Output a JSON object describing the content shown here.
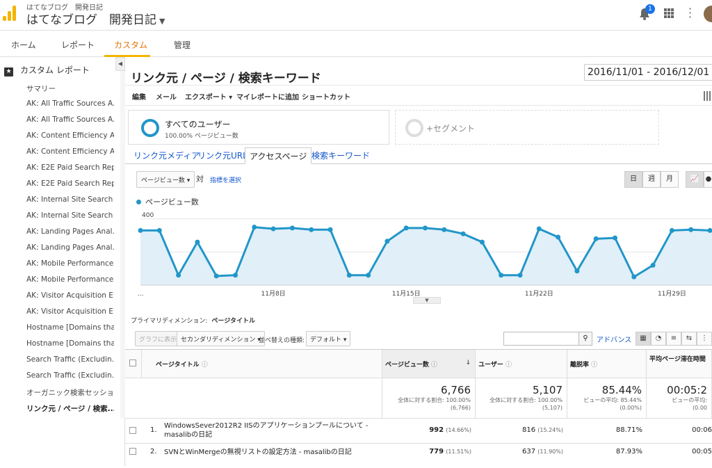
{
  "header": {
    "account": "はてなブログ　開発日記",
    "property": "はてなブログ　開発日記",
    "notification_count": "1",
    "colors": {
      "logo": "#f4b400",
      "accent": "#e37400",
      "series": "#2196c9"
    }
  },
  "nav": {
    "tabs": [
      {
        "label": "ホーム"
      },
      {
        "label": "レポート"
      },
      {
        "label": "カスタム",
        "active": true
      },
      {
        "label": "管理"
      }
    ]
  },
  "sidebar": {
    "heading": "カスタム レポート",
    "items": [
      "サマリー",
      "AK: All Traffic Sources A...",
      "AK: All Traffic Sources A...",
      "AK: Content Efficiency A...",
      "AK: Content Efficiency A...",
      "AK: E2E Paid Search Rep...",
      "AK: E2E Paid Search Rep...",
      "AK: Internal Site Search ...",
      "AK: Internal Site Search ...",
      "AK: Landing Pages Anal...",
      "AK: Landing Pages Anal...",
      "AK: Mobile Performance...",
      "AK: Mobile Performance...",
      "AK: Visitor Acquisition E...",
      "AK: Visitor Acquisition E...",
      "Hostname [Domains tha...",
      "Hostname [Domains tha...",
      "Search Traffic (Excludin...",
      "Search Traffic (Excludin...",
      "オーガニック検索セッション",
      "リンク元 / ページ / 検索..."
    ]
  },
  "report": {
    "title": "リンク元 / ページ / 検索キーワード",
    "date_range": "2016/11/01 - 2016/12/01",
    "toolbar": [
      "編集",
      "メール",
      "エクスポート ▾",
      "マイレポートに追加",
      "ショートカット"
    ],
    "segment": {
      "name": "すべてのユーザー",
      "sub": "100.00% ページビュー数",
      "add": "+セグメント"
    },
    "explorer_tabs": [
      "リンク元メディア",
      "リンク元URL",
      "アクセスページ",
      "検索キーワード"
    ],
    "metric_select": "ページビュー数",
    "vs": "対",
    "pick_metric": "指標を選択",
    "granularity": [
      "日",
      "週",
      "月"
    ],
    "legend": "ページビュー数",
    "primary_dimension_label": "プライマリディメンション:",
    "primary_dimension_value": "ページタイトル",
    "graph_btn": "グラフに表示",
    "secondary_dimension": "セカンダリディメンション ▾",
    "sort_type_label": "並べ替えの種類:",
    "sort_type": "デフォルト ▾",
    "advanced": "アドバンス"
  },
  "chart_data": {
    "type": "area",
    "series": [
      {
        "name": "ページビュー数",
        "values": [
          330,
          330,
          60,
          260,
          55,
          60,
          350,
          340,
          345,
          335,
          335,
          60,
          60,
          265,
          345,
          345,
          335,
          310,
          260,
          60,
          60,
          340,
          290,
          85,
          280,
          285,
          50,
          120,
          330,
          335,
          330,
          290
        ]
      }
    ],
    "x": [
      "11/1",
      "11/2",
      "11/3",
      "11/4",
      "11/5",
      "11/6",
      "11/7",
      "11/8",
      "11/9",
      "11/10",
      "11/11",
      "11/12",
      "11/13",
      "11/14",
      "11/15",
      "11/16",
      "11/17",
      "11/18",
      "11/19",
      "11/20",
      "11/21",
      "11/22",
      "11/23",
      "11/24",
      "11/25",
      "11/26",
      "11/27",
      "11/28",
      "11/29",
      "11/30",
      "12/1",
      "12/2"
    ],
    "xtick_labels": [
      "...",
      "11月8日",
      "11月15日",
      "11月22日",
      "11月29日"
    ],
    "xtick_index": [
      0,
      7,
      14,
      21,
      28
    ],
    "yticks": [
      200,
      400
    ],
    "ylim": [
      0,
      420
    ],
    "grid": true
  },
  "table": {
    "columns": [
      "ページタイトル",
      "ページビュー数",
      "ユーザー",
      "離脱率",
      "平均ページ滞在時間"
    ],
    "totals": [
      {
        "big": "6,766",
        "l1": "全体に対する割合: 100.00%",
        "l2": "(6,766)"
      },
      {
        "big": "5,107",
        "l1": "全体に対する割合: 100.00%",
        "l2": "(5,107)"
      },
      {
        "big": "85.44%",
        "l1": "ビューの平均: 85.44%",
        "l2": "(0.00%)"
      },
      {
        "big": "00:05:2",
        "l1": "ビューの平均:",
        "l2": "(0.00"
      }
    ],
    "rows": [
      {
        "n": "1.",
        "title": "WindowsSever2012R2 IISのアプリケーションプールについて - masalibの日記",
        "pv": "992",
        "pv_pct": "(14.66%)",
        "users": "816",
        "users_pct": "(15.24%)",
        "bounce": "88.71%",
        "time": "00:06"
      },
      {
        "n": "2.",
        "title": "SVNとWinMergeの無視リストの設定方法 - masalibの日記",
        "pv": "779",
        "pv_pct": "(11.51%)",
        "users": "637",
        "users_pct": "(11.90%)",
        "bounce": "87.93%",
        "time": "00:05"
      }
    ]
  }
}
